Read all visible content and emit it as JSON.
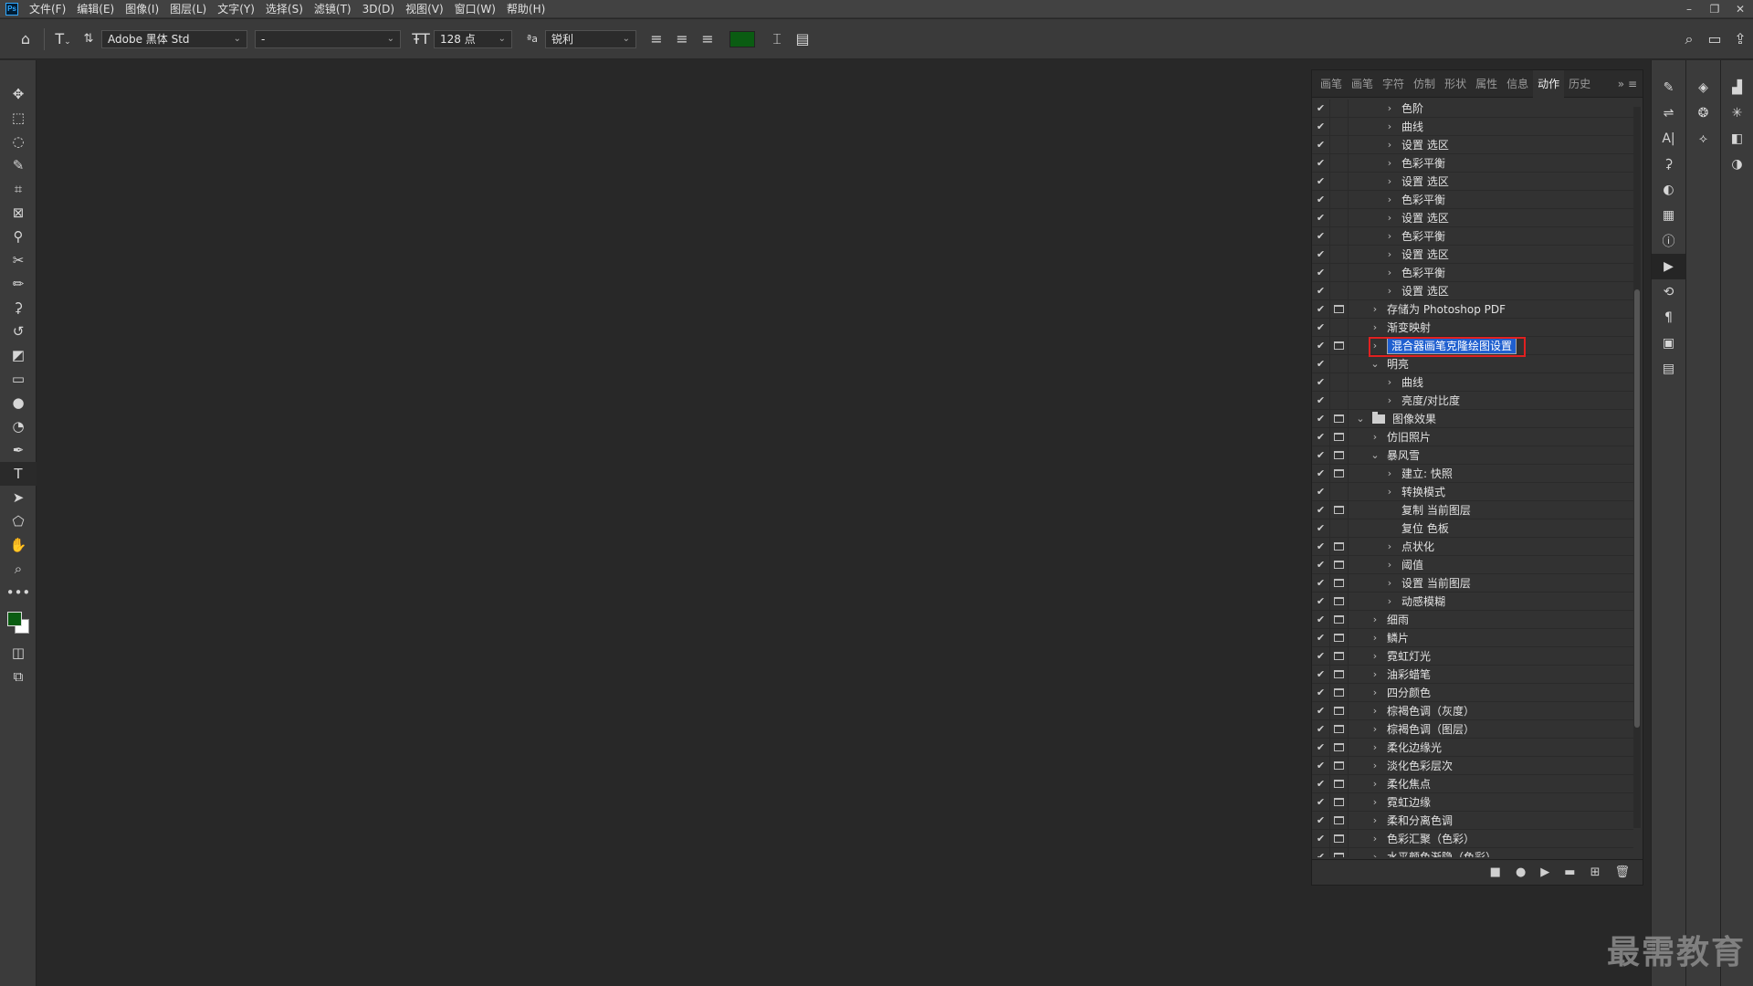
{
  "menubar": {
    "logo": "Ps",
    "items": [
      "文件(F)",
      "编辑(E)",
      "图像(I)",
      "图层(L)",
      "文字(Y)",
      "选择(S)",
      "滤镜(T)",
      "3D(D)",
      "视图(V)",
      "窗口(W)",
      "帮助(H)"
    ],
    "window_controls": [
      "–",
      "❐",
      "✕"
    ]
  },
  "options": {
    "font_family": "Adobe 黑体 Std",
    "font_style": "-",
    "font_size": "128 点",
    "antialias": "锐利",
    "text_color": "#0a5c12"
  },
  "panel": {
    "tabs": [
      "画笔",
      "画笔",
      "字符",
      "仿制",
      "形状",
      "属性",
      "信息",
      "动作",
      "历史"
    ],
    "active_tab": "动作",
    "rows": [
      {
        "c": "✔",
        "d": false,
        "ind": 2,
        "arr": "›",
        "label": "色阶"
      },
      {
        "c": "✔",
        "d": false,
        "ind": 2,
        "arr": "›",
        "label": "曲线"
      },
      {
        "c": "✔",
        "d": false,
        "ind": 2,
        "arr": "›",
        "label": "设置 选区"
      },
      {
        "c": "✔",
        "d": false,
        "ind": 2,
        "arr": "›",
        "label": "色彩平衡"
      },
      {
        "c": "✔",
        "d": false,
        "ind": 2,
        "arr": "›",
        "label": "设置 选区"
      },
      {
        "c": "✔",
        "d": false,
        "ind": 2,
        "arr": "›",
        "label": "色彩平衡"
      },
      {
        "c": "✔",
        "d": false,
        "ind": 2,
        "arr": "›",
        "label": "设置 选区"
      },
      {
        "c": "✔",
        "d": false,
        "ind": 2,
        "arr": "›",
        "label": "色彩平衡"
      },
      {
        "c": "✔",
        "d": false,
        "ind": 2,
        "arr": "›",
        "label": "设置 选区"
      },
      {
        "c": "✔",
        "d": false,
        "ind": 2,
        "arr": "›",
        "label": "色彩平衡"
      },
      {
        "c": "✔",
        "d": false,
        "ind": 2,
        "arr": "›",
        "label": "设置 选区"
      },
      {
        "c": "✔",
        "d": true,
        "ind": 1,
        "arr": "›",
        "label": "存储为 Photoshop PDF"
      },
      {
        "c": "✔",
        "d": false,
        "ind": 1,
        "arr": "›",
        "label": "渐变映射"
      },
      {
        "c": "✔",
        "d": true,
        "ind": 1,
        "arr": "›",
        "label": "混合器画笔克隆绘图设置",
        "edit": true
      },
      {
        "c": "✔",
        "d": false,
        "ind": 1,
        "arr": "⌄",
        "label": "明亮"
      },
      {
        "c": "✔",
        "d": false,
        "ind": 2,
        "arr": "›",
        "label": "曲线"
      },
      {
        "c": "✔",
        "d": false,
        "ind": 2,
        "arr": "›",
        "label": "亮度/对比度"
      },
      {
        "c": "✔",
        "d": true,
        "ind": 0,
        "arr": "⌄",
        "label": "图像效果",
        "folder": true
      },
      {
        "c": "✔",
        "d": true,
        "ind": 1,
        "arr": "›",
        "label": "仿旧照片"
      },
      {
        "c": "✔",
        "d": true,
        "ind": 1,
        "arr": "⌄",
        "label": "暴风雪"
      },
      {
        "c": "✔",
        "d": true,
        "ind": 2,
        "arr": "›",
        "label": "建立: 快照"
      },
      {
        "c": "✔",
        "d": false,
        "ind": 2,
        "arr": "›",
        "label": "转换模式"
      },
      {
        "c": "✔",
        "d": true,
        "ind": 2,
        "arr": "",
        "label": "复制 当前图层"
      },
      {
        "c": "✔",
        "d": false,
        "ind": 2,
        "arr": "",
        "label": "复位 色板"
      },
      {
        "c": "✔",
        "d": true,
        "ind": 2,
        "arr": "›",
        "label": "点状化"
      },
      {
        "c": "✔",
        "d": true,
        "ind": 2,
        "arr": "›",
        "label": "阈值"
      },
      {
        "c": "✔",
        "d": true,
        "ind": 2,
        "arr": "›",
        "label": "设置 当前图层"
      },
      {
        "c": "✔",
        "d": true,
        "ind": 2,
        "arr": "›",
        "label": "动感模糊"
      },
      {
        "c": "✔",
        "d": true,
        "ind": 1,
        "arr": "›",
        "label": "细雨"
      },
      {
        "c": "✔",
        "d": true,
        "ind": 1,
        "arr": "›",
        "label": "鳞片"
      },
      {
        "c": "✔",
        "d": true,
        "ind": 1,
        "arr": "›",
        "label": "霓虹灯光"
      },
      {
        "c": "✔",
        "d": true,
        "ind": 1,
        "arr": "›",
        "label": "油彩蜡笔"
      },
      {
        "c": "✔",
        "d": true,
        "ind": 1,
        "arr": "›",
        "label": "四分颜色"
      },
      {
        "c": "✔",
        "d": true,
        "ind": 1,
        "arr": "›",
        "label": "棕褐色调（灰度）"
      },
      {
        "c": "✔",
        "d": true,
        "ind": 1,
        "arr": "›",
        "label": "棕褐色调（图层）"
      },
      {
        "c": "✔",
        "d": true,
        "ind": 1,
        "arr": "›",
        "label": "柔化边缘光"
      },
      {
        "c": "✔",
        "d": true,
        "ind": 1,
        "arr": "›",
        "label": "淡化色彩层次"
      },
      {
        "c": "✔",
        "d": true,
        "ind": 1,
        "arr": "›",
        "label": "柔化焦点"
      },
      {
        "c": "✔",
        "d": true,
        "ind": 1,
        "arr": "›",
        "label": "霓虹边缘"
      },
      {
        "c": "✔",
        "d": true,
        "ind": 1,
        "arr": "›",
        "label": "柔和分离色调"
      },
      {
        "c": "✔",
        "d": true,
        "ind": 1,
        "arr": "›",
        "label": "色彩汇聚（色彩）"
      },
      {
        "c": "✔",
        "d": true,
        "ind": 1,
        "arr": "›",
        "label": "水平颜色渐隐（色彩）"
      }
    ],
    "footer_icons": [
      "■",
      "●",
      "▶",
      "▬",
      "⊞",
      "🗑"
    ]
  },
  "watermark": "最需教育"
}
